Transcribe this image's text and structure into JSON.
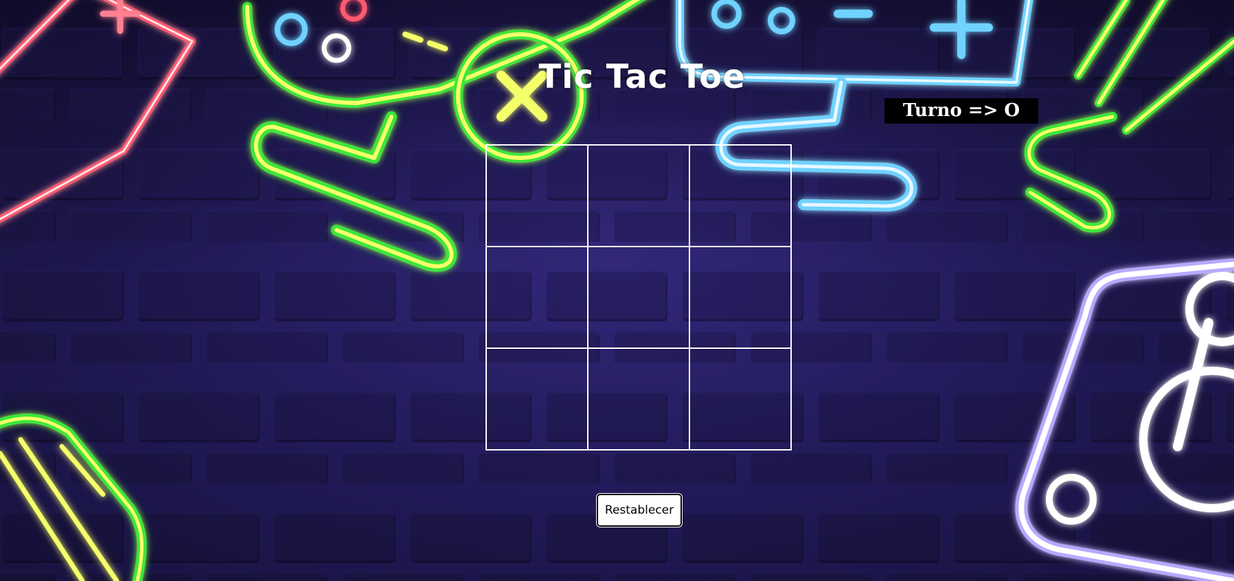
{
  "game": {
    "title": "Tic Tac Toe",
    "turn_text": "Turno => O",
    "board": {
      "cells": [
        "",
        "",
        "",
        "",
        "",
        "",
        "",
        "",
        ""
      ]
    },
    "reset_label": "Restablecer"
  },
  "colors": {
    "background": "#231a55",
    "brick": "#2b2170",
    "brick_shadow": "#110c2e",
    "neon_yellow": "#f5ff6a",
    "neon_green": "#3ee63a",
    "neon_blue": "#6fd2ff",
    "neon_red": "#ff5a6e",
    "neon_white": "#e6e2f5",
    "grid_line": "#ffffff",
    "turn_box_bg": "#000000"
  },
  "decorations": [
    "gamepad-neon-icon",
    "handheld-console-neon-icon",
    "cable-neon-icon",
    "joystick-neon-icon",
    "cartridge-neon-icon"
  ]
}
